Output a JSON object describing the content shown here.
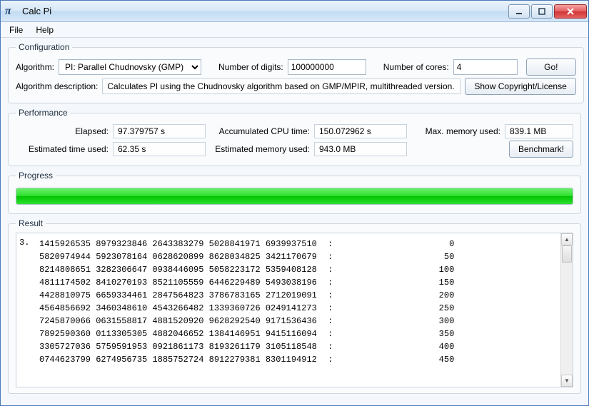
{
  "window": {
    "title": "Calc Pi"
  },
  "menu": {
    "file": "File",
    "help": "Help"
  },
  "config": {
    "legend": "Configuration",
    "algo_label": "Algorithm:",
    "algo_value": "PI: Parallel Chudnovsky (GMP)",
    "digits_label": "Number of digits:",
    "digits_value": "100000000",
    "cores_label": "Number of cores:",
    "cores_value": "4",
    "go_btn": "Go!",
    "desc_label": "Algorithm description:",
    "desc_value": "Calculates PI using the Chudnovsky algorithm based on GMP/MPIR, multithreaded version.",
    "license_btn": "Show Copyright/License"
  },
  "perf": {
    "legend": "Performance",
    "elapsed_label": "Elapsed:",
    "elapsed_value": "97.379757 s",
    "accum_label": "Accumulated CPU time:",
    "accum_value": "150.072962 s",
    "maxmem_label": "Max. memory used:",
    "maxmem_value": "839.1 MB",
    "esttime_label": "Estimated time used:",
    "esttime_value": "62.35 s",
    "estmem_label": "Estimated memory used:",
    "estmem_value": "943.0 MB",
    "bench_btn": "Benchmark!"
  },
  "progress": {
    "legend": "Progress"
  },
  "result": {
    "legend": "Result",
    "leading": "3.",
    "lines": [
      {
        "d": "1415926535 8979323846 2643383279 5028841971 6939937510",
        "i": "0"
      },
      {
        "d": "5820974944 5923078164 0628620899 8628034825 3421170679",
        "i": "50"
      },
      {
        "d": "8214808651 3282306647 0938446095 5058223172 5359408128",
        "i": "100"
      },
      {
        "d": "4811174502 8410270193 8521105559 6446229489 5493038196",
        "i": "150"
      },
      {
        "d": "4428810975 6659334461 2847564823 3786783165 2712019091",
        "i": "200"
      },
      {
        "d": "4564856692 3460348610 4543266482 1339360726 0249141273",
        "i": "250"
      },
      {
        "d": "7245870066 0631558817 4881520920 9628292540 9171536436",
        "i": "300"
      },
      {
        "d": "7892590360 0113305305 4882046652 1384146951 9415116094",
        "i": "350"
      },
      {
        "d": "3305727036 5759591953 0921861173 8193261179 3105118548",
        "i": "400"
      },
      {
        "d": "0744623799 6274956735 1885752724 8912279381 8301194912",
        "i": "450"
      }
    ]
  }
}
